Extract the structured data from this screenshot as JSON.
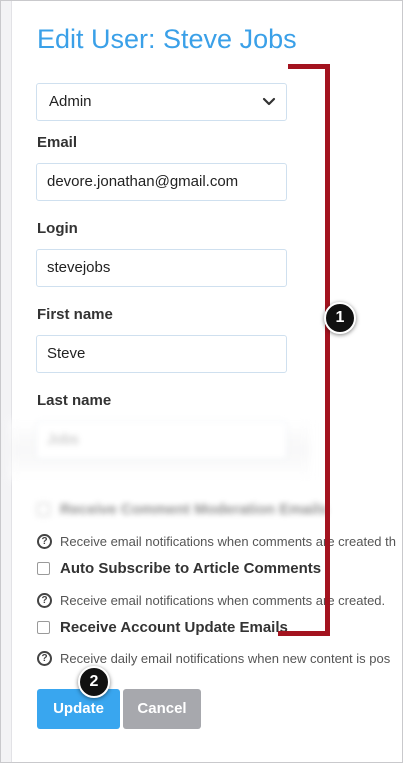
{
  "page": {
    "title": "Edit User: Steve Jobs"
  },
  "form": {
    "role_select": {
      "value": "Admin"
    },
    "email": {
      "label": "Email",
      "value": "devore.jonathan@gmail.com"
    },
    "login": {
      "label": "Login",
      "value": "stevejobs"
    },
    "first_name": {
      "label": "First name",
      "value": "Steve"
    },
    "last_name": {
      "label": "Last name",
      "value": "Jobs"
    }
  },
  "options": [
    {
      "label": "Receive Comment Moderation Emails",
      "help": "Receive email notifications when comments are created th",
      "checked": false
    },
    {
      "label": "Auto Subscribe to Article Comments",
      "help": "Receive email notifications when comments are created.",
      "checked": false
    },
    {
      "label": "Receive Account Update Emails",
      "help": "Receive daily email notifications when new content is pos",
      "checked": false
    }
  ],
  "buttons": {
    "update_label": "Update",
    "cancel_label": "Cancel"
  },
  "annotations": {
    "callout_1": "1",
    "callout_2": "2"
  },
  "colors": {
    "title": "#3aa0e8",
    "update_button": "#39a6ef",
    "cancel_button": "#a7a8ad",
    "callout_bracket": "#a3131f"
  },
  "icons": {
    "select_chevron": "chevron-down-icon",
    "help": "question-circle-icon"
  }
}
